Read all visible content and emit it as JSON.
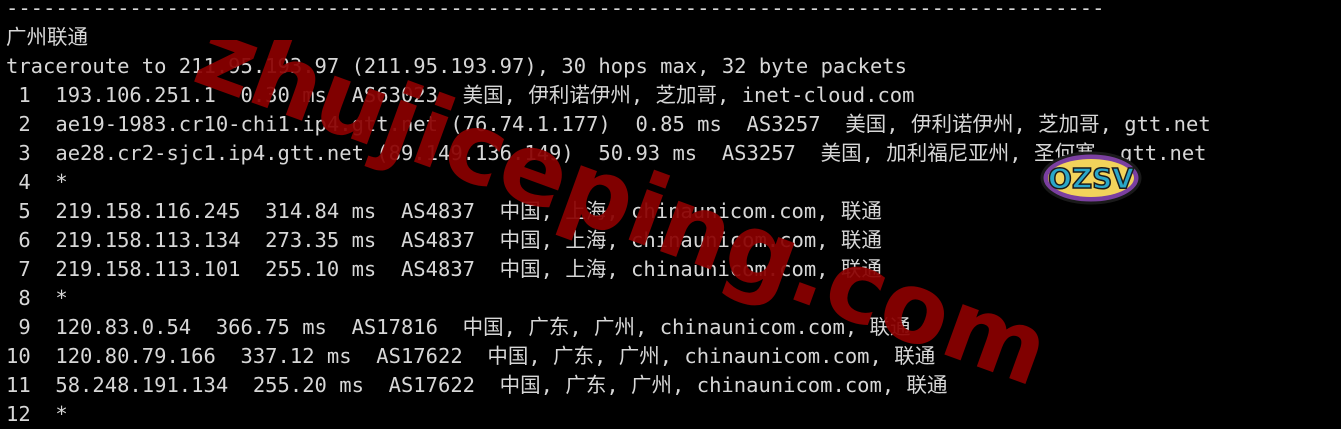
{
  "terminal": {
    "separator": "-----------------------------------------------------------------------------------------",
    "header": "广州联通",
    "command": "traceroute to 211.95.193.97 (211.95.193.97), 30 hops max, 32 byte packets",
    "hops": [
      " 1  193.106.251.1  0.30 ms  AS63023  美国, 伊利诺伊州, 芝加哥, inet-cloud.com",
      " 2  ae19-1983.cr10-chi1.ip4.gtt.net (76.74.1.177)  0.85 ms  AS3257  美国, 伊利诺伊州, 芝加哥, gtt.net",
      " 3  ae28.cr2-sjc1.ip4.gtt.net (89.149.136.149)  50.93 ms  AS3257  美国, 加利福尼亚州, 圣何塞, gtt.net",
      " 4  *",
      " 5  219.158.116.245  314.84 ms  AS4837  中国, 上海, chinaunicom.com, 联通",
      " 6  219.158.113.134  273.35 ms  AS4837  中国, 上海, chinaunicom.com, 联通",
      " 7  219.158.113.101  255.10 ms  AS4837  中国, 上海, chinaunicom.com, 联通",
      " 8  *",
      " 9  120.83.0.54  366.75 ms  AS17816  中国, 广东, 广州, chinaunicom.com, 联通",
      "10  120.80.79.166  337.12 ms  AS17622  中国, 广东, 广州, chinaunicom.com, 联通",
      "11  58.248.191.134  255.20 ms  AS17622  中国, 广东, 广州, chinaunicom.com, 联通",
      "12  *"
    ]
  },
  "watermark": {
    "text": "zhujiceping.com",
    "color": "#8b0000"
  },
  "sticker": {
    "text": "OZSV"
  },
  "colors": {
    "background": "#000000",
    "foreground": "#d7d7d7"
  }
}
